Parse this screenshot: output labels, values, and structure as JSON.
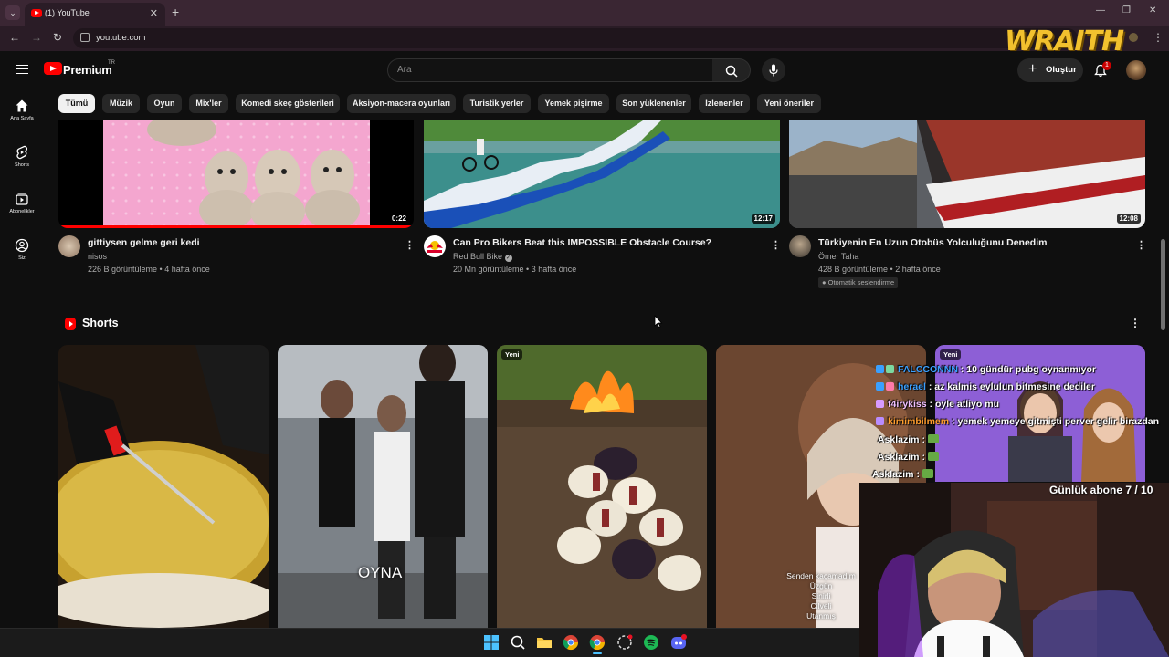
{
  "browser": {
    "tab_title": "(1) YouTube",
    "url": "youtube.com",
    "overlay_logo": "WRAITH"
  },
  "masthead": {
    "logo_text": "Premium",
    "country_code": "TR",
    "search_placeholder": "Ara",
    "create_label": "Oluştur",
    "notification_count": "1"
  },
  "guide": [
    {
      "label": "Ana Sayfa",
      "icon": "home-icon"
    },
    {
      "label": "Shorts",
      "icon": "shorts-icon"
    },
    {
      "label": "Abonelikler",
      "icon": "subscriptions-icon"
    },
    {
      "label": "Siz",
      "icon": "you-icon"
    }
  ],
  "chips": [
    "Tümü",
    "Müzik",
    "Oyun",
    "Mix'ler",
    "Komedi skeç gösterileri",
    "Aksiyon-macera oyunları",
    "Turistik yerler",
    "Yemek pişirme",
    "Son yüklenenler",
    "İzlenenler",
    "Yeni öneriler"
  ],
  "videos": [
    {
      "title": "gittiysen gelme geri kedi",
      "channel": "nisos",
      "meta": "226 B görüntüleme • 4 hafta önce",
      "duration": "0:22",
      "verified": false
    },
    {
      "title": "Can Pro Bikers Beat this IMPOSSIBLE Obstacle Course?",
      "channel": "Red Bull Bike",
      "meta": "20 Mn görüntüleme • 3 hafta önce",
      "duration": "12:17",
      "verified": true
    },
    {
      "title": "Türkiyenin En Uzun Otobüs Yolculuğunu Denedim",
      "channel": "Ömer Taha",
      "meta": "428 B görüntüleme • 2 hafta önce",
      "duration": "12:08",
      "verified": false,
      "badge": "Otomatik seslendirme"
    }
  ],
  "shorts": {
    "title": "Shorts",
    "items": [
      {
        "new_badge": ""
      },
      {
        "new_badge": "",
        "overlay": "OYNA"
      },
      {
        "new_badge": "Yeni"
      },
      {
        "new_badge": "",
        "overlay_lines": [
          "Senden kaçamadım",
          "Üzgün",
          "Sinirli",
          "Cilveli",
          "Utanmış"
        ]
      },
      {
        "new_badge": "Yeni"
      }
    ]
  },
  "stream_chat": [
    {
      "user": "FALCCONNN",
      "message": ": 10 gündür pubg oynanmıyor",
      "color": "#3aa0ff"
    },
    {
      "user": "herael",
      "message": ": az kalmis eylulun bitmesine dediler",
      "color": "#3aa0ff"
    },
    {
      "user": "f4irykiss",
      "message": ": oyle atliyo mu",
      "color": "#f0c0ff"
    },
    {
      "user": "kimimbilmem",
      "message": ": yemek yemeye gitmişti perver gelir birazdan",
      "color": "#ff9d2e"
    },
    {
      "user": "Asklazim",
      "message": ":",
      "color": "#ffffff"
    },
    {
      "user": "Asklazim",
      "message": ":",
      "color": "#ffffff"
    },
    {
      "user": "Asklazim",
      "message": ":",
      "color": "#ffffff"
    }
  ],
  "subscriber_goal": "Günlük abone 7 / 10",
  "taskbar": [
    "windows-start-icon",
    "search-icon",
    "file-explorer-icon",
    "chrome-icon",
    "chrome-icon",
    "app-icon",
    "spotify-icon",
    "discord-icon"
  ]
}
